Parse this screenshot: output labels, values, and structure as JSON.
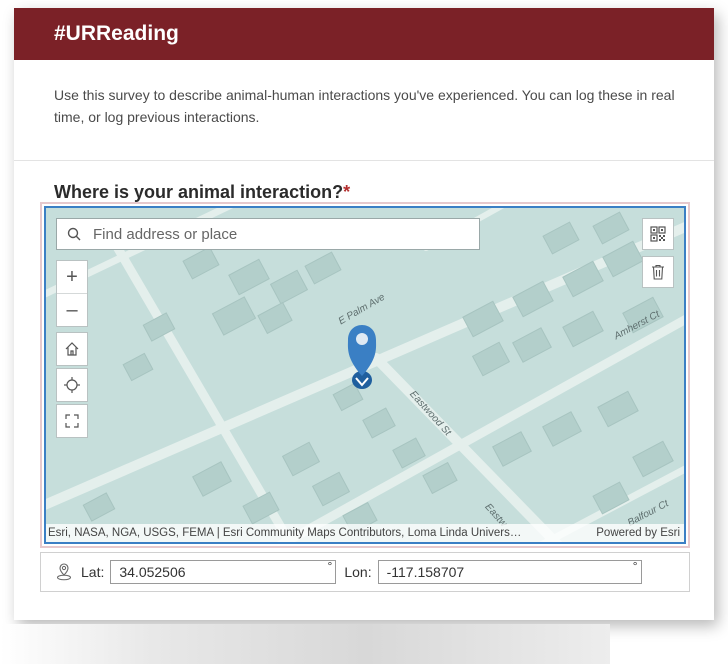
{
  "header": {
    "title": "#URReading"
  },
  "description": "Use this survey to describe animal-human interactions you've experienced. You can log these in real time, or log previous interactions.",
  "question": {
    "label": "Where is your animal interaction?",
    "required_mark": "*"
  },
  "map": {
    "search_placeholder": "Find address or place",
    "zoom_in_label": "+",
    "zoom_out_label": "–",
    "attribution": "Esri, NASA, NGA, USGS, FEMA | Esri Community Maps Contributors, Loma Linda Univers…",
    "powered_by": "Powered by Esri",
    "streets": {
      "palm": "E Palm Ave",
      "amherst": "Amherst Ct",
      "eastwood": "Eastwood St",
      "eastwood_bottom": "Eastw",
      "balfour": "Balfour Ct"
    },
    "icons": {
      "search": "search-icon",
      "home": "home-icon",
      "locate": "locate-icon",
      "fullscreen": "fullscreen-icon",
      "qr": "qr-code-icon",
      "trash": "trash-icon",
      "pin": "map-pin-icon"
    }
  },
  "coordinates": {
    "lat_label": "Lat:",
    "lat_value": "34.052506",
    "lon_label": "Lon:",
    "lon_value": "-117.158707",
    "degree_symbol": "°"
  },
  "colors": {
    "header_bg": "#7b2127",
    "map_border": "#3b7fc4",
    "pin": "#3a7fc4",
    "required": "#b32d2d"
  }
}
